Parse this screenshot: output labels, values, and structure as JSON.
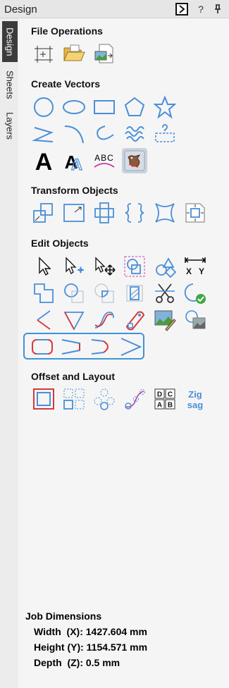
{
  "window": {
    "title": "Design",
    "help_label": "?",
    "pin_label": "❙"
  },
  "tabs": [
    "Design",
    "Sheets",
    "Layers"
  ],
  "sections": {
    "file": "File Operations",
    "vectors": "Create Vectors",
    "transform": "Transform Objects",
    "edit": "Edit Objects",
    "offset": "Offset and Layout"
  },
  "icon_text": {
    "text_A": "A",
    "abc": "ABC",
    "x_label": "X",
    "y_label": "Y",
    "d": "D",
    "c": "C",
    "a": "A",
    "b": "B",
    "nest": "Zig\nsag"
  },
  "job": {
    "title": "Job Dimensions",
    "width_label": "Width  (X):",
    "width_value": "1427.604 mm",
    "height_label": "Height (Y):",
    "height_value": "1154.571 mm",
    "depth_label": "Depth  (Z):",
    "depth_value": "0.5 mm"
  },
  "colors": {
    "icon_blue": "#4a8fd8",
    "accent_red": "#d9383a",
    "highlight_box": "#3d94d6"
  }
}
